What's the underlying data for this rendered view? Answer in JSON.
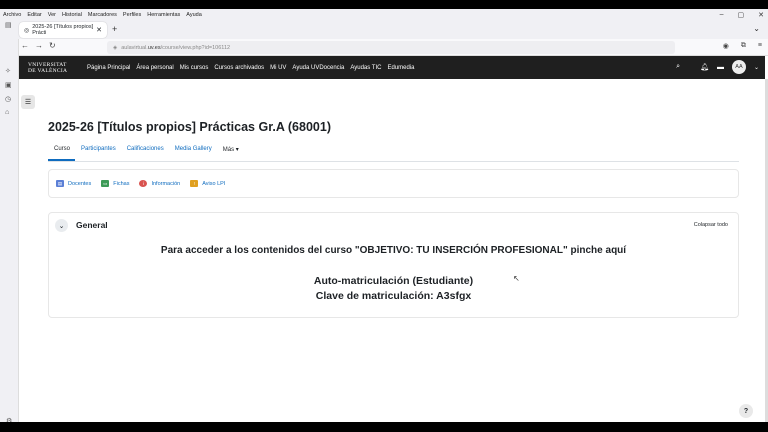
{
  "menubar": [
    "Archivo",
    "Editar",
    "Ver",
    "Historial",
    "Marcadores",
    "Perfiles",
    "Herramientas",
    "Ayuda"
  ],
  "window_controls": {
    "minimize": "–",
    "maximize": "▢",
    "close": "✕"
  },
  "browser_tab": {
    "title": "2025-26 [Títulos propios] Prácti",
    "close": "✕"
  },
  "new_tab": "+",
  "url": {
    "prefix": "aulavirtual.",
    "domain": "uv.es",
    "path": "/course/view.php?id=106112"
  },
  "nav": {
    "back": "←",
    "forward": "→",
    "reload": "↻"
  },
  "moodle_nav": {
    "logo_line1": "VNIVERSITAT",
    "logo_line2": "DE VALÈNCIA",
    "links": [
      "Página Principal",
      "Área personal",
      "Mis cursos",
      "Cursos archivados",
      "Mi UV",
      "Ayuda UVDocencia",
      "Ayudas TIC",
      "Edumedia"
    ],
    "avatar": "AA"
  },
  "course": {
    "title": "2025-26 [Títulos propios] Prácticas Gr.A (68001)",
    "tabs": [
      "Curso",
      "Participantes",
      "Calificaciones",
      "Media Gallery",
      "Más ▾"
    ],
    "links": [
      {
        "label": "Docentes",
        "color": "#5b7fd6"
      },
      {
        "label": "Fichas",
        "color": "#3d9a57"
      },
      {
        "label": "Información",
        "color": "#d9534f"
      },
      {
        "label": "Aviso LPI",
        "color": "#e0a020"
      }
    ],
    "section": "General",
    "collapse": "Colapsar todo",
    "line1": "Para acceder a los contenidos del curso \"OBJETIVO: TU INSERCIÓN PROFESIONAL\" pinche aquí",
    "line2": "Auto-matriculación (Estudiante)",
    "line3": "Clave de matriculación: A3sfgx"
  },
  "help": "?"
}
